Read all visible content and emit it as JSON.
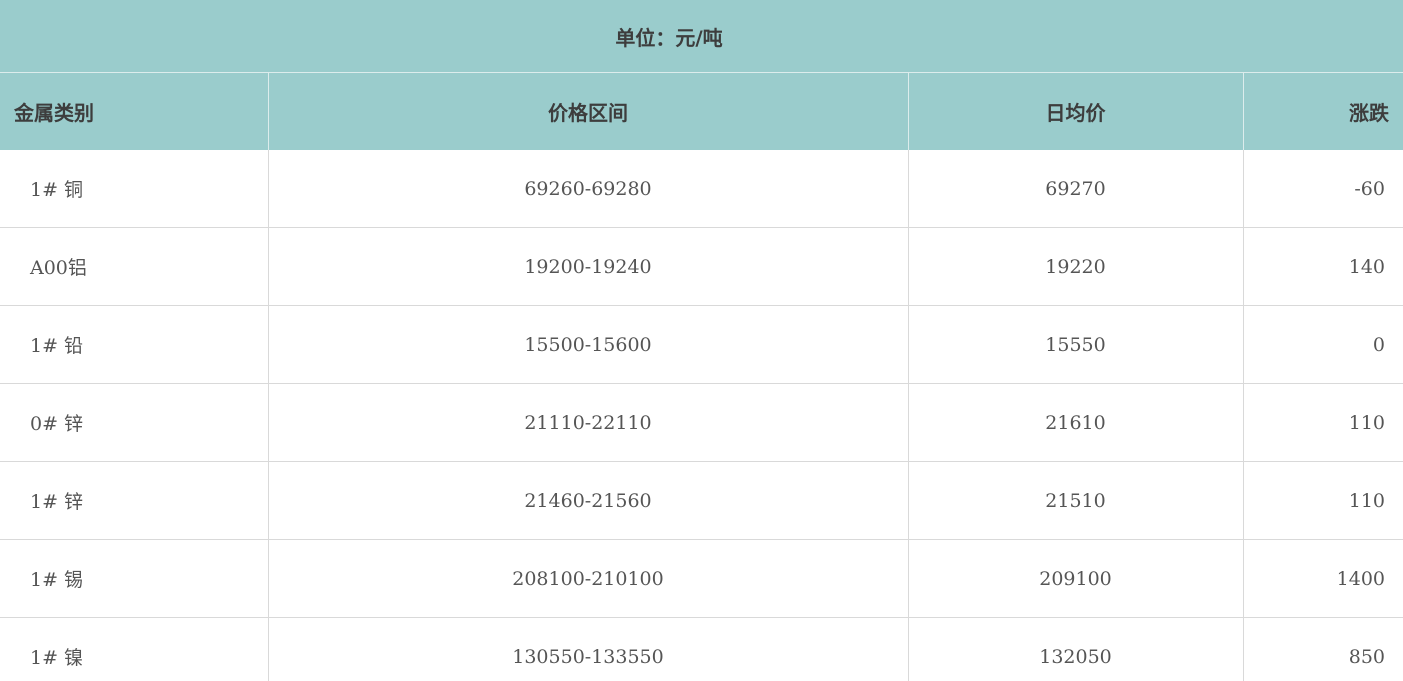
{
  "unit_label": "单位：元/吨",
  "headers": {
    "metal": "金属类别",
    "range": "价格区间",
    "avg": "日均价",
    "change": "涨跌"
  },
  "rows": [
    {
      "metal": "1# 铜",
      "range": "69260-69280",
      "avg": "69270",
      "change": "-60"
    },
    {
      "metal": "A00铝",
      "range": "19200-19240",
      "avg": "19220",
      "change": "140"
    },
    {
      "metal": "1# 铅",
      "range": "15500-15600",
      "avg": "15550",
      "change": "0"
    },
    {
      "metal": "0# 锌",
      "range": "21110-22110",
      "avg": "21610",
      "change": "110"
    },
    {
      "metal": "1# 锌",
      "range": "21460-21560",
      "avg": "21510",
      "change": "110"
    },
    {
      "metal": "1# 锡",
      "range": "208100-210100",
      "avg": "209100",
      "change": "1400"
    },
    {
      "metal": "1# 镍",
      "range": "130550-133550",
      "avg": "132050",
      "change": "850"
    }
  ],
  "colors": {
    "header_bg": "#9acccc",
    "header_text": "#3d3d3d",
    "body_text": "#555555",
    "grid": "#d9d9d9"
  }
}
